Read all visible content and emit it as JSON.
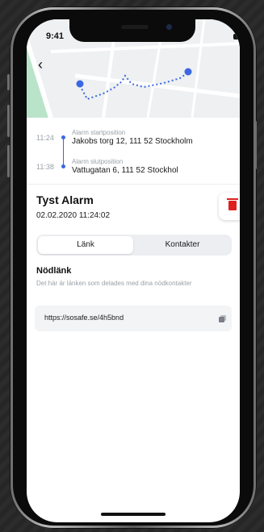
{
  "status": {
    "time": "9:41"
  },
  "nav": {
    "back_label": "‹"
  },
  "timeline": {
    "start": {
      "time": "11:24",
      "label": "Alarm startposition",
      "address": "Jakobs torg 12, 111 52 Stockholm"
    },
    "end": {
      "time": "11:38",
      "label": "Alarm slutposition",
      "address": "Vattugatan 6, 111 52 Stockhol"
    }
  },
  "alarm": {
    "title": "Tyst Alarm",
    "datetime": "02.02.2020  11:24:02"
  },
  "tabs": [
    {
      "label": "Länk",
      "selected": true
    },
    {
      "label": "Kontakter",
      "selected": false
    }
  ],
  "emergency_link": {
    "title": "Nödlänk",
    "description": "Det här är länken som delades med dina nödkontakter",
    "url": "https://sosafe.se/4h5bnd"
  },
  "colors": {
    "accent": "#3b67e0",
    "danger": "#e02020"
  },
  "icons": {
    "delete": "trash-icon",
    "copy": "copy-icon",
    "back": "chevron-left-icon"
  }
}
